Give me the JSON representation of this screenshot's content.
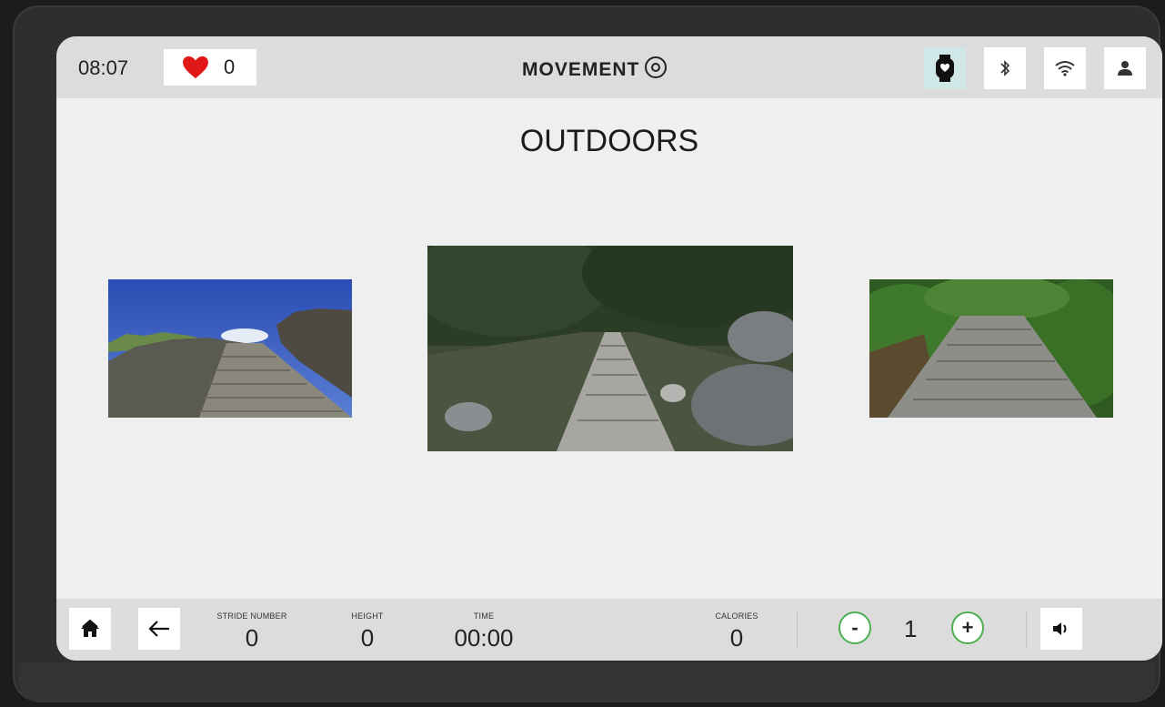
{
  "header": {
    "time": "08:07",
    "heart_rate": "0",
    "brand": "MOVEMENT"
  },
  "page": {
    "title": "OUTDOORS"
  },
  "scenes": [
    {
      "name": "great-wall-stairs"
    },
    {
      "name": "forest-stone-path"
    },
    {
      "name": "garden-stairs"
    }
  ],
  "footer": {
    "stride_label": "STRIDE NUMBER",
    "stride_value": "0",
    "height_label": "HEIGHT",
    "height_value": "0",
    "time_label": "TIME",
    "time_value": "00:00",
    "calories_label": "CALORIES",
    "calories_value": "0",
    "level_minus": "-",
    "level_value": "1",
    "level_plus": "+"
  },
  "colors": {
    "accent_green": "#4caf50",
    "heart_red": "#e01818",
    "watch_active": "#cfe7e6"
  },
  "icons": [
    "heart-icon",
    "watch-icon",
    "bluetooth-icon",
    "wifi-icon",
    "user-icon",
    "home-icon",
    "back-arrow-icon",
    "volume-icon"
  ]
}
